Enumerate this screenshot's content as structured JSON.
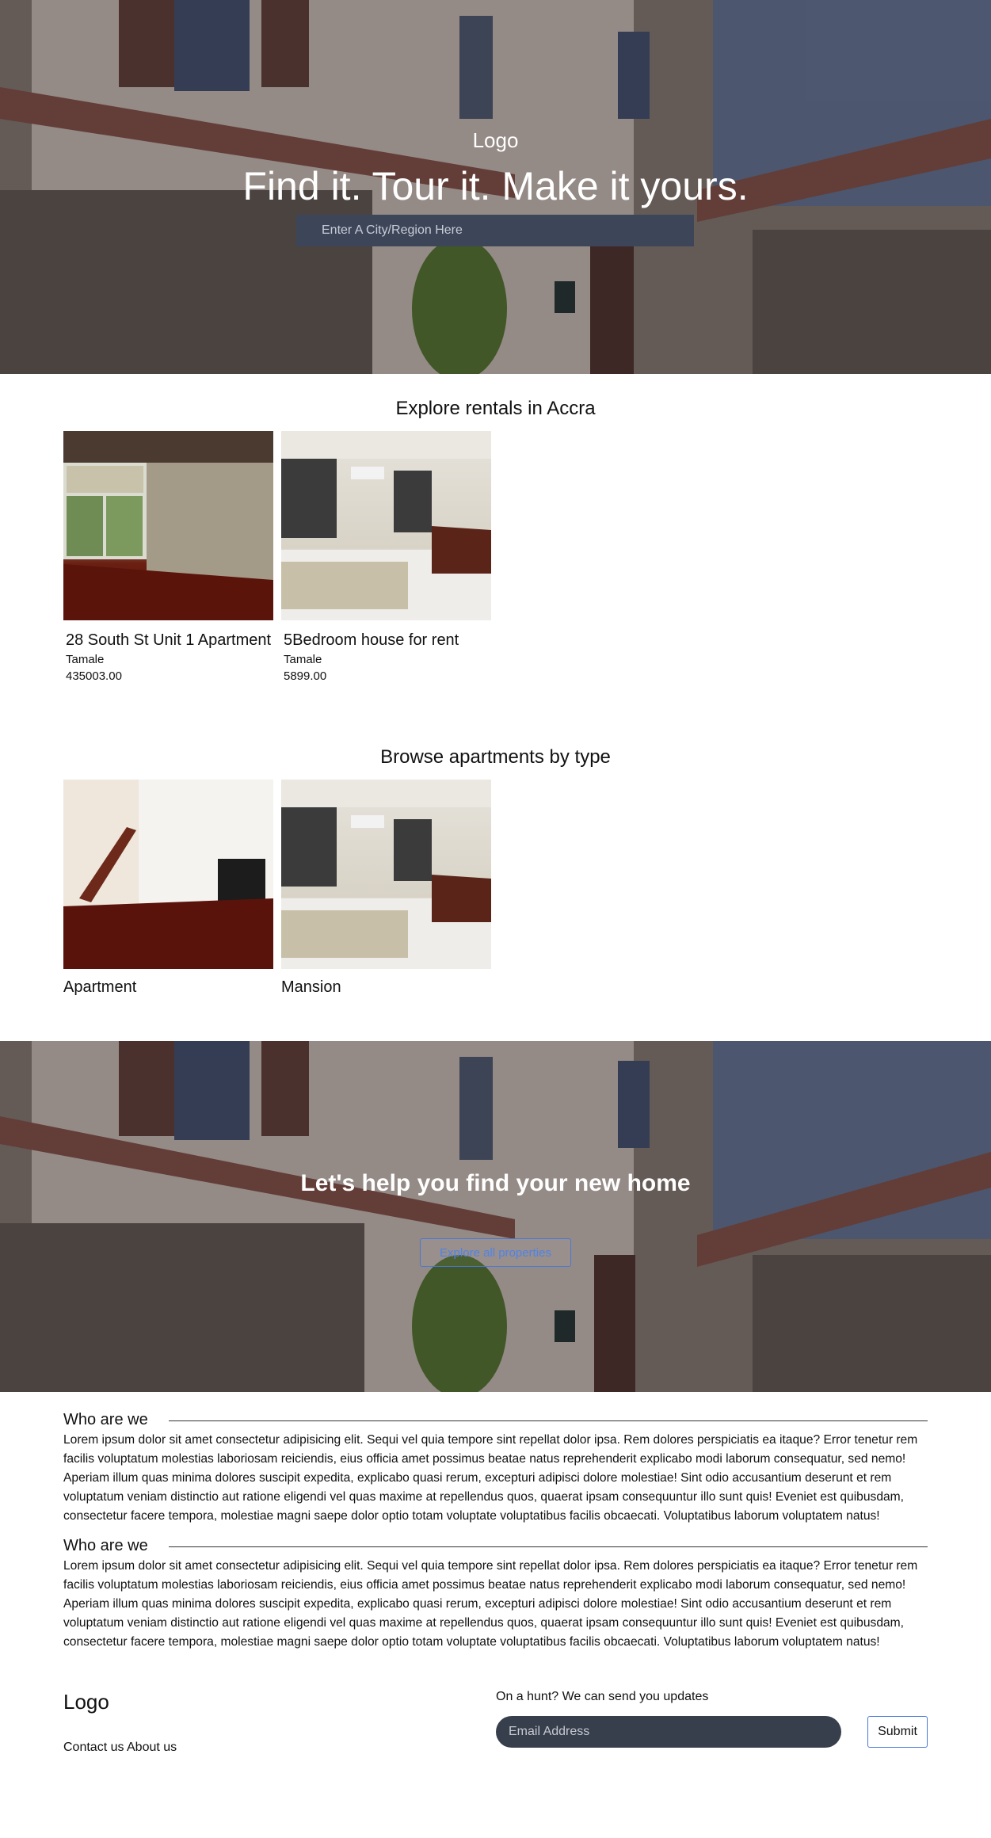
{
  "hero": {
    "logo": "Logo",
    "title": "Find it. Tour it. Make it yours.",
    "search_placeholder": "Enter A City/Region Here"
  },
  "rentals": {
    "title": "Explore rentals in Accra",
    "items": [
      {
        "name": "28 South St Unit 1 Apartment",
        "city": "Tamale",
        "price": "435003.00"
      },
      {
        "name": "5Bedroom house for rent",
        "city": "Tamale",
        "price": "5899.00"
      }
    ]
  },
  "types": {
    "title": "Browse apartments by type",
    "items": [
      {
        "name": "Apartment"
      },
      {
        "name": "Mansion"
      }
    ]
  },
  "cta": {
    "title": "Let's help you find your new home",
    "button": "Explore all properties"
  },
  "about": [
    {
      "title": "Who are we",
      "text": "Lorem ipsum dolor sit amet consectetur adipisicing elit. Sequi vel quia tempore sint repellat dolor ipsa. Rem dolores perspiciatis ea itaque? Error tenetur rem facilis voluptatum molestias laboriosam reiciendis, eius officia amet possimus beatae natus reprehenderit explicabo modi laborum consequatur, sed nemo! Aperiam illum quas minima dolores suscipit expedita, explicabo quasi rerum, excepturi adipisci dolore molestiae! Sint odio accusantium deserunt et rem voluptatum veniam distinctio aut ratione eligendi vel quas maxime at repellendus quos, quaerat ipsam consequuntur illo sunt quis! Eveniet est quibusdam, consectetur facere tempora, molestiae magni saepe dolor optio totam voluptate voluptatibus facilis obcaecati. Voluptatibus laborum voluptatem natus!"
    },
    {
      "title": "Who are we",
      "text": "Lorem ipsum dolor sit amet consectetur adipisicing elit. Sequi vel quia tempore sint repellat dolor ipsa. Rem dolores perspiciatis ea itaque? Error tenetur rem facilis voluptatum molestias laboriosam reiciendis, eius officia amet possimus beatae natus reprehenderit explicabo modi laborum consequatur, sed nemo! Aperiam illum quas minima dolores suscipit expedita, explicabo quasi rerum, excepturi adipisci dolore molestiae! Sint odio accusantium deserunt et rem voluptatum veniam distinctio aut ratione eligendi vel quas maxime at repellendus quos, quaerat ipsam consequuntur illo sunt quis! Eveniet est quibusdam, consectetur facere tempora, molestiae magni saepe dolor optio totam voluptate voluptatibus facilis obcaecati. Voluptatibus laborum voluptatem natus!"
    }
  ],
  "footer": {
    "logo": "Logo",
    "about_link": "About us",
    "contact_link": "Contact us",
    "newsletter_prompt": "On a hunt? We can send you updates",
    "email_placeholder": "Email Address",
    "submit_label": "Submit"
  }
}
